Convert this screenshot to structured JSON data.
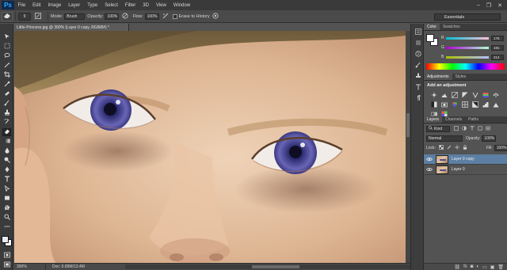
{
  "app": {
    "logo": "Ps"
  },
  "menu": [
    "File",
    "Edit",
    "Image",
    "Layer",
    "Type",
    "Select",
    "Filter",
    "3D",
    "View",
    "Window"
  ],
  "window_controls": [
    "–",
    "❐",
    "✕"
  ],
  "options": {
    "mode_label": "Mode:",
    "mode_value": "Brush",
    "opacity_label": "Opacity:",
    "opacity_value": "100%",
    "flow_label": "Flow:",
    "flow_value": "100%",
    "erase_history_label": "Erase to History",
    "brush_size": "9",
    "workspace": "Essentials"
  },
  "document": {
    "tab_title": "Little-Princess.jpg @ 300% (Layer 0 copy, RGB/8#) *",
    "zoom": "300%",
    "doc_info": "Doc: 6.89M/13.4M"
  },
  "color_panel": {
    "tabs": [
      "Color",
      "Swatches"
    ],
    "channels": [
      {
        "label": "R",
        "value": "176"
      },
      {
        "label": "G",
        "value": "191"
      },
      {
        "label": "B",
        "value": "214"
      }
    ]
  },
  "adjustments_panel": {
    "tabs": [
      "Adjustments",
      "Styles"
    ],
    "title": "Add an adjustment",
    "icons": [
      "brightness-icon",
      "levels-icon",
      "curves-icon",
      "exposure-icon",
      "vibrance-icon",
      "hue-saturation-icon",
      "color-balance-icon",
      "black-white-icon",
      "photo-filter-icon",
      "channel-mixer-icon",
      "color-lookup-icon",
      "invert-icon",
      "posterize-icon",
      "threshold-icon",
      "gradient-map-icon",
      "selective-color-icon"
    ]
  },
  "layers_panel": {
    "tabs": [
      "Layers",
      "Channels",
      "Paths"
    ],
    "filter_label": "Kind",
    "blend_mode": "Normal",
    "opacity_label": "Opacity:",
    "opacity_value": "100%",
    "lock_label": "Lock:",
    "fill_label": "Fill:",
    "fill_value": "100%",
    "layers": [
      {
        "name": "Layer 0 copy",
        "active": true
      },
      {
        "name": "Layer 0",
        "active": false
      }
    ]
  }
}
